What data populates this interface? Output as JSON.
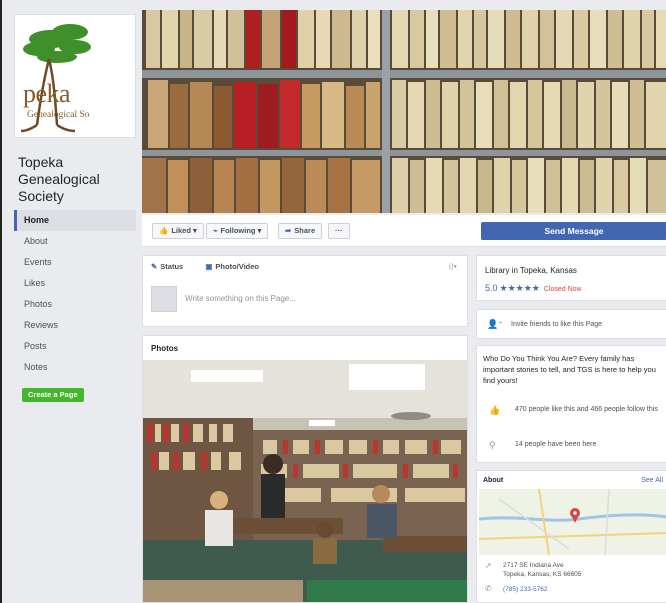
{
  "page": {
    "name": "Topeka Genealogical Society",
    "logo_text": "peka",
    "logo_subtext": "Genealogical So"
  },
  "sidebar": {
    "items": [
      {
        "label": "Home"
      },
      {
        "label": "About"
      },
      {
        "label": "Events"
      },
      {
        "label": "Likes"
      },
      {
        "label": "Photos"
      },
      {
        "label": "Reviews"
      },
      {
        "label": "Posts"
      },
      {
        "label": "Notes"
      }
    ],
    "create_page_label": "Create a Page"
  },
  "actions": {
    "liked_label": "Liked",
    "following_label": "Following",
    "share_label": "Share",
    "more_label": "···",
    "send_message_label": "Send Message"
  },
  "composer": {
    "status_label": "Status",
    "photo_video_label": "Photo/Video",
    "placeholder": "Write something on this Page..."
  },
  "photos": {
    "header": "Photos"
  },
  "about": {
    "category": "Library in Topeka, Kansas",
    "rating": "5.0",
    "stars": "★★★★★",
    "rating_stars_count": 5,
    "status": "Closed Now",
    "invite_text": "Invite friends to like this Page",
    "description": "Who Do You Think You Are? Every family has important stories to tell, and TGS is here to help you find yours!",
    "likes_text": "470 people like this and 466 people follow this",
    "visits_text": "14 people have been here",
    "about_header": "About",
    "see_all": "See All",
    "address_line1": "2717 SE Indiana Ave",
    "address_line2": "Topeka, Kansas, KS 66605",
    "phone": "(785) 233-5762"
  },
  "colors": {
    "facebook_blue": "#4267b2",
    "create_green": "#42b72a",
    "closed_red": "#e0433f",
    "logo_tree_green": "#3f8f2a"
  },
  "icons": {
    "liked": "thumbs-up-icon",
    "following": "rss-icon",
    "share": "share-arrow-icon",
    "status": "pencil-icon",
    "photo": "photo-icon",
    "invite": "add-person-icon",
    "likes": "thumbs-up-icon",
    "visits": "map-pin-icon",
    "address": "location-arrow-icon",
    "phone": "phone-icon"
  }
}
